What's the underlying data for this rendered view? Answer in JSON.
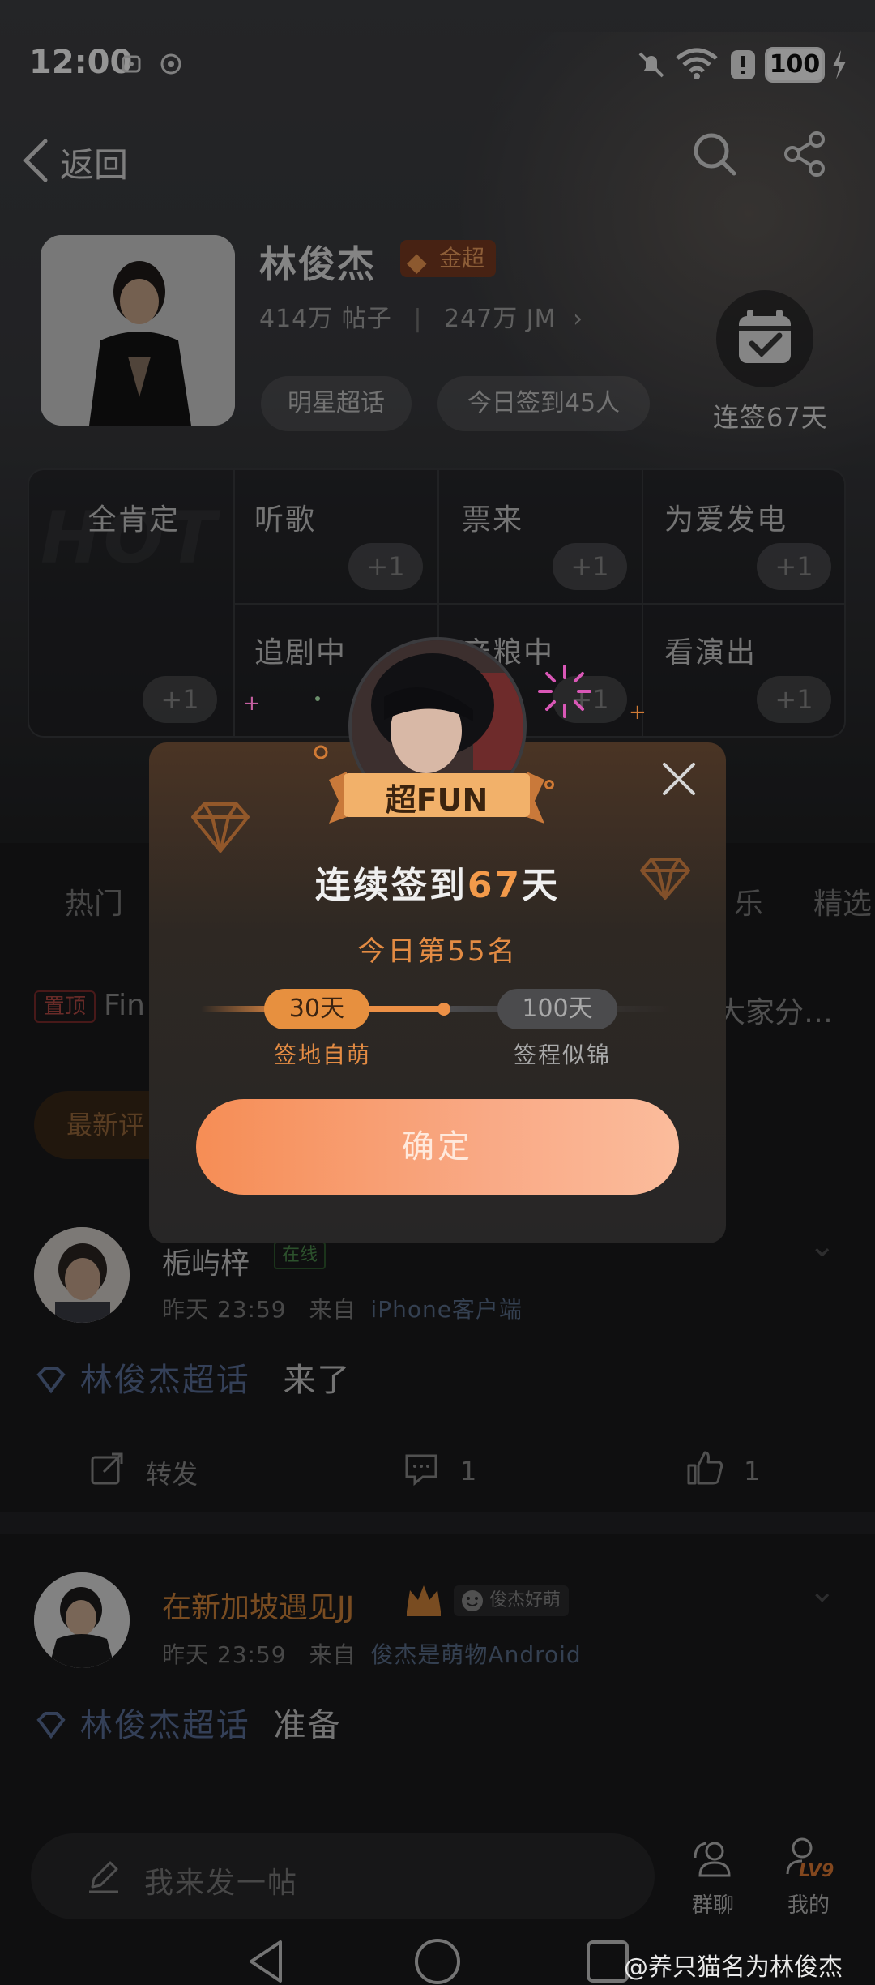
{
  "status_bar": {
    "time": "12:00",
    "battery": "100"
  },
  "nav": {
    "back_label": "返回"
  },
  "profile": {
    "name": "林俊杰",
    "badge": "金超",
    "posts": "414万 帖子",
    "fans": "247万 JM",
    "chips": [
      "明星超话",
      "今日签到45人"
    ],
    "checkin_label": "连签67天"
  },
  "grid": {
    "watermark": "HOT",
    "cells": [
      "全肯定",
      "听歌",
      "票来",
      "为爱发电",
      "追剧中",
      "产粮中",
      "看演出"
    ],
    "plus": "+1"
  },
  "tabs": [
    "热门",
    "乐",
    "精选"
  ],
  "pinned": {
    "badge": "置顶",
    "left_text": "Fin",
    "right_text": "大家分…"
  },
  "latest_pill": "最新评",
  "posts": [
    {
      "name": "栀屿梓",
      "tag": "在线",
      "time": "昨天 23:59",
      "from_prefix": "来自",
      "source": "iPhone客户端",
      "topic": "林俊杰超话",
      "text": "来了",
      "repost": "转发",
      "comments": "1",
      "likes": "1"
    },
    {
      "name": "在新加坡遇见JJ",
      "tag": "俊杰好萌",
      "time": "昨天 23:59",
      "from_prefix": "来自",
      "source": "俊杰是萌物Android",
      "topic": "林俊杰超话",
      "text": "准备"
    }
  ],
  "bottom": {
    "compose_placeholder": "我来发一帖",
    "group_chat": "群聊",
    "mine": "我的",
    "level": "LV9"
  },
  "modal": {
    "ribbon": "超FUN",
    "title_prefix": "连续签到",
    "title_days": "67",
    "title_suffix": "天",
    "rank": "今日第55名",
    "milestone_1_days": "30天",
    "milestone_1_label": "签地自萌",
    "milestone_2_days": "100天",
    "milestone_2_label": "签程似锦",
    "progress_fraction": 0.67,
    "confirm": "确定"
  },
  "watermark": "@养只猫名为林俊杰",
  "colors": {
    "accent": "#f39a4a",
    "confirm_start": "#f68d55",
    "confirm_end": "#fbbc9c",
    "topic": "#5a6f98"
  }
}
